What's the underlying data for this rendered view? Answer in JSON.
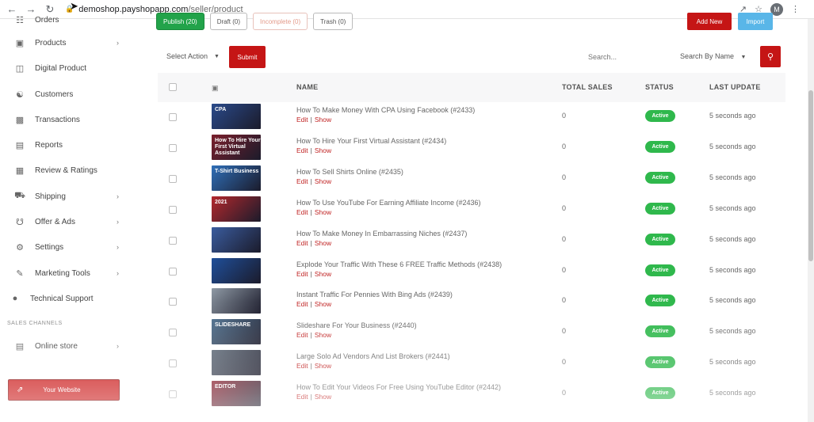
{
  "browser": {
    "url_host": "demoshop.payshopapp.com",
    "url_path": "/seller/product",
    "avatar_letter": "M"
  },
  "sidebar": {
    "items": [
      {
        "label": "Orders",
        "icon": "orders-icon",
        "chevron": false
      },
      {
        "label": "Products",
        "icon": "products-icon",
        "chevron": true
      },
      {
        "label": "Digital Product",
        "icon": "digital-product-icon",
        "chevron": false
      },
      {
        "label": "Customers",
        "icon": "customers-icon",
        "chevron": false
      },
      {
        "label": "Transactions",
        "icon": "transactions-icon",
        "chevron": false
      },
      {
        "label": "Reports",
        "icon": "reports-icon",
        "chevron": false
      },
      {
        "label": "Review & Ratings",
        "icon": "review-icon",
        "chevron": false
      },
      {
        "label": "Shipping",
        "icon": "shipping-icon",
        "chevron": true
      },
      {
        "label": "Offer & Ads",
        "icon": "offer-icon",
        "chevron": true
      },
      {
        "label": "Settings",
        "icon": "settings-icon",
        "chevron": true
      },
      {
        "label": "Marketing Tools",
        "icon": "marketing-icon",
        "chevron": true
      },
      {
        "label": "Technical Support",
        "icon": "support-icon",
        "chevron": false
      }
    ],
    "section_label": "SALES CHANNELS",
    "online_store": "Online store",
    "your_website": "Your Website"
  },
  "tabs": {
    "publish": "Publish (20)",
    "draft": "Draft (0)",
    "incomplete": "Incomplete (0)",
    "trash": "Trash (0)"
  },
  "actions": {
    "add_new": "Add New",
    "import": "Import",
    "select_action": "Select Action",
    "submit": "Submit",
    "search_placeholder": "Search...",
    "search_by": "Search By Name"
  },
  "table": {
    "headers": {
      "name": "NAME",
      "total_sales": "TOTAL SALES",
      "status": "STATUS",
      "last_update": "LAST UPDATE"
    },
    "edit_label": "Edit",
    "show_label": "Show",
    "rows": [
      {
        "name": "How To Make Money With CPA Using Facebook (#2433)",
        "sales": "0",
        "status": "Active",
        "updated": "5 seconds ago",
        "thumb_text": "CPA",
        "thumb_color": "#2a4a8a"
      },
      {
        "name": "How To Hire Your First Virtual Assistant (#2434)",
        "sales": "0",
        "status": "Active",
        "updated": "5 seconds ago",
        "thumb_text": "How To Hire Your First Virtual Assistant",
        "thumb_color": "#7a1f2c"
      },
      {
        "name": "How To Sell Shirts Online (#2435)",
        "sales": "0",
        "status": "Active",
        "updated": "5 seconds ago",
        "thumb_text": "T-Shirt Business",
        "thumb_color": "#2f6fb8"
      },
      {
        "name": "How To Use YouTube For Earning Affiliate Income (#2436)",
        "sales": "0",
        "status": "Active",
        "updated": "5 seconds ago",
        "thumb_text": "2021",
        "thumb_color": "#b3282d"
      },
      {
        "name": "How To Make Money In Embarrassing Niches (#2437)",
        "sales": "0",
        "status": "Active",
        "updated": "5 seconds ago",
        "thumb_text": "",
        "thumb_color": "#3a5c9e"
      },
      {
        "name": "Explode Your Traffic With These 6 FREE Traffic Methods (#2438)",
        "sales": "0",
        "status": "Active",
        "updated": "5 seconds ago",
        "thumb_text": "",
        "thumb_color": "#1f4f9a"
      },
      {
        "name": "Instant Traffic For Pennies With Bing Ads (#2439)",
        "sales": "0",
        "status": "Active",
        "updated": "5 seconds ago",
        "thumb_text": "",
        "thumb_color": "#8f9aa5"
      },
      {
        "name": "Slideshare For Your Business (#2440)",
        "sales": "0",
        "status": "Active",
        "updated": "5 seconds ago",
        "thumb_text": "SLIDESHARE",
        "thumb_color": "#4b6d8c"
      },
      {
        "name": "Large Solo Ad Vendors And List Brokers (#2441)",
        "sales": "0",
        "status": "Active",
        "updated": "5 seconds ago",
        "thumb_text": "",
        "thumb_color": "#5b6775"
      },
      {
        "name": "How To Edit Your Videos For Free Using YouTube Editor (#2442)",
        "sales": "0",
        "status": "Active",
        "updated": "5 seconds ago",
        "thumb_text": "EDITOR",
        "thumb_color": "#8a1a2a"
      }
    ]
  },
  "colors": {
    "brand_red": "#c51515",
    "publish_green": "#22a34a",
    "active_green": "#2fb84c",
    "import_blue": "#59b6e8"
  }
}
